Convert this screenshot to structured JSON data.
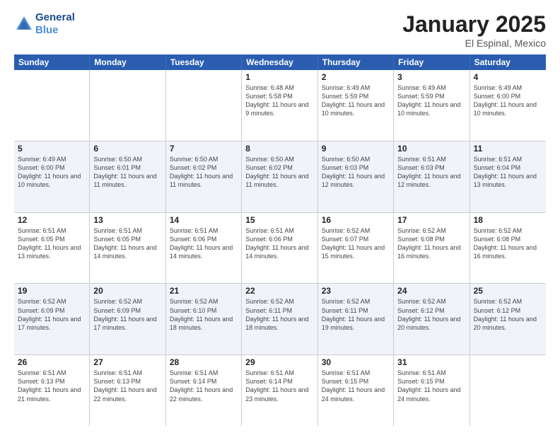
{
  "header": {
    "logo_line1": "General",
    "logo_line2": "Blue",
    "title": "January 2025",
    "subtitle": "El Espinal, Mexico"
  },
  "weekdays": [
    "Sunday",
    "Monday",
    "Tuesday",
    "Wednesday",
    "Thursday",
    "Friday",
    "Saturday"
  ],
  "rows": [
    {
      "alt": false,
      "cells": [
        {
          "day": "",
          "info": ""
        },
        {
          "day": "",
          "info": ""
        },
        {
          "day": "",
          "info": ""
        },
        {
          "day": "1",
          "info": "Sunrise: 6:48 AM\nSunset: 5:58 PM\nDaylight: 11 hours and 9 minutes."
        },
        {
          "day": "2",
          "info": "Sunrise: 6:49 AM\nSunset: 5:59 PM\nDaylight: 11 hours and 10 minutes."
        },
        {
          "day": "3",
          "info": "Sunrise: 6:49 AM\nSunset: 5:59 PM\nDaylight: 11 hours and 10 minutes."
        },
        {
          "day": "4",
          "info": "Sunrise: 6:49 AM\nSunset: 6:00 PM\nDaylight: 11 hours and 10 minutes."
        }
      ]
    },
    {
      "alt": true,
      "cells": [
        {
          "day": "5",
          "info": "Sunrise: 6:49 AM\nSunset: 6:00 PM\nDaylight: 11 hours and 10 minutes."
        },
        {
          "day": "6",
          "info": "Sunrise: 6:50 AM\nSunset: 6:01 PM\nDaylight: 11 hours and 11 minutes."
        },
        {
          "day": "7",
          "info": "Sunrise: 6:50 AM\nSunset: 6:02 PM\nDaylight: 11 hours and 11 minutes."
        },
        {
          "day": "8",
          "info": "Sunrise: 6:50 AM\nSunset: 6:02 PM\nDaylight: 11 hours and 11 minutes."
        },
        {
          "day": "9",
          "info": "Sunrise: 6:50 AM\nSunset: 6:03 PM\nDaylight: 11 hours and 12 minutes."
        },
        {
          "day": "10",
          "info": "Sunrise: 6:51 AM\nSunset: 6:03 PM\nDaylight: 11 hours and 12 minutes."
        },
        {
          "day": "11",
          "info": "Sunrise: 6:51 AM\nSunset: 6:04 PM\nDaylight: 11 hours and 13 minutes."
        }
      ]
    },
    {
      "alt": false,
      "cells": [
        {
          "day": "12",
          "info": "Sunrise: 6:51 AM\nSunset: 6:05 PM\nDaylight: 11 hours and 13 minutes."
        },
        {
          "day": "13",
          "info": "Sunrise: 6:51 AM\nSunset: 6:05 PM\nDaylight: 11 hours and 14 minutes."
        },
        {
          "day": "14",
          "info": "Sunrise: 6:51 AM\nSunset: 6:06 PM\nDaylight: 11 hours and 14 minutes."
        },
        {
          "day": "15",
          "info": "Sunrise: 6:51 AM\nSunset: 6:06 PM\nDaylight: 11 hours and 14 minutes."
        },
        {
          "day": "16",
          "info": "Sunrise: 6:52 AM\nSunset: 6:07 PM\nDaylight: 11 hours and 15 minutes."
        },
        {
          "day": "17",
          "info": "Sunrise: 6:52 AM\nSunset: 6:08 PM\nDaylight: 11 hours and 16 minutes."
        },
        {
          "day": "18",
          "info": "Sunrise: 6:52 AM\nSunset: 6:08 PM\nDaylight: 11 hours and 16 minutes."
        }
      ]
    },
    {
      "alt": true,
      "cells": [
        {
          "day": "19",
          "info": "Sunrise: 6:52 AM\nSunset: 6:09 PM\nDaylight: 11 hours and 17 minutes."
        },
        {
          "day": "20",
          "info": "Sunrise: 6:52 AM\nSunset: 6:09 PM\nDaylight: 11 hours and 17 minutes."
        },
        {
          "day": "21",
          "info": "Sunrise: 6:52 AM\nSunset: 6:10 PM\nDaylight: 11 hours and 18 minutes."
        },
        {
          "day": "22",
          "info": "Sunrise: 6:52 AM\nSunset: 6:11 PM\nDaylight: 11 hours and 18 minutes."
        },
        {
          "day": "23",
          "info": "Sunrise: 6:52 AM\nSunset: 6:11 PM\nDaylight: 11 hours and 19 minutes."
        },
        {
          "day": "24",
          "info": "Sunrise: 6:52 AM\nSunset: 6:12 PM\nDaylight: 11 hours and 20 minutes."
        },
        {
          "day": "25",
          "info": "Sunrise: 6:52 AM\nSunset: 6:12 PM\nDaylight: 11 hours and 20 minutes."
        }
      ]
    },
    {
      "alt": false,
      "cells": [
        {
          "day": "26",
          "info": "Sunrise: 6:51 AM\nSunset: 6:13 PM\nDaylight: 11 hours and 21 minutes."
        },
        {
          "day": "27",
          "info": "Sunrise: 6:51 AM\nSunset: 6:13 PM\nDaylight: 11 hours and 22 minutes."
        },
        {
          "day": "28",
          "info": "Sunrise: 6:51 AM\nSunset: 6:14 PM\nDaylight: 11 hours and 22 minutes."
        },
        {
          "day": "29",
          "info": "Sunrise: 6:51 AM\nSunset: 6:14 PM\nDaylight: 11 hours and 23 minutes."
        },
        {
          "day": "30",
          "info": "Sunrise: 6:51 AM\nSunset: 6:15 PM\nDaylight: 11 hours and 24 minutes."
        },
        {
          "day": "31",
          "info": "Sunrise: 6:51 AM\nSunset: 6:15 PM\nDaylight: 11 hours and 24 minutes."
        },
        {
          "day": "",
          "info": ""
        }
      ]
    }
  ]
}
